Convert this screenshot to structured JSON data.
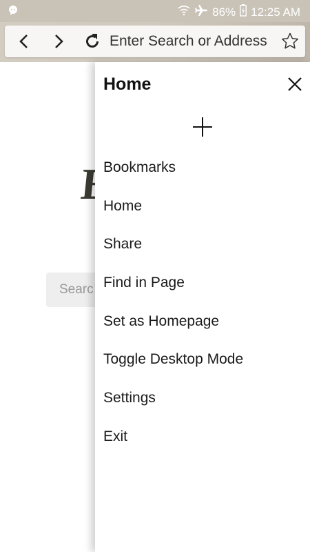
{
  "status_bar": {
    "battery": "86%",
    "time": "12:25 AM",
    "icons": [
      "notification-icon",
      "wifi-icon",
      "airplane-mode-icon",
      "battery-charging-icon"
    ]
  },
  "toolbar": {
    "address_placeholder": "Enter Search or Address",
    "icons": [
      "back-icon",
      "forward-icon",
      "reload-icon",
      "star-icon"
    ]
  },
  "background_page": {
    "search_placeholder": "Searc"
  },
  "drawer": {
    "title": "Home",
    "icons": [
      "close-icon",
      "add-icon"
    ],
    "items": [
      {
        "label": "Bookmarks"
      },
      {
        "label": "Home"
      },
      {
        "label": "Share"
      },
      {
        "label": "Find in Page"
      },
      {
        "label": "Set as Homepage"
      },
      {
        "label": "Toggle Desktop Mode"
      },
      {
        "label": "Settings"
      },
      {
        "label": "Exit"
      }
    ]
  }
}
